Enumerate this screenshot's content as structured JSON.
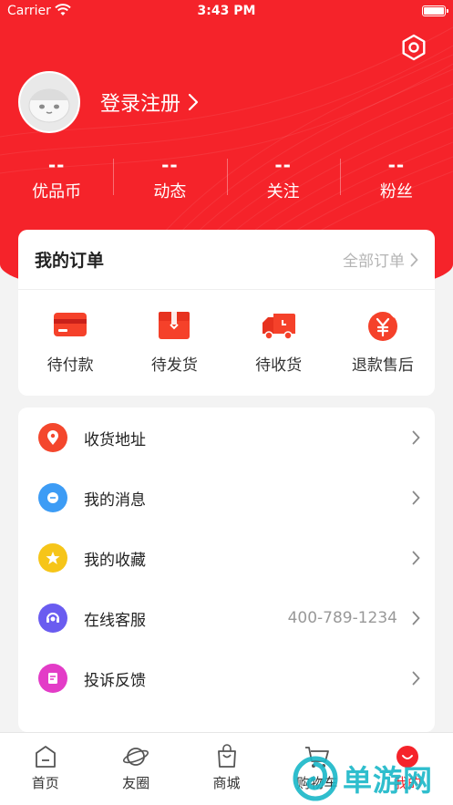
{
  "status_bar": {
    "carrier": "Carrier",
    "time": "3:43 PM"
  },
  "header": {
    "login_label": "登录注册",
    "stats": [
      {
        "value": "--",
        "label": "优品币"
      },
      {
        "value": "--",
        "label": "动态"
      },
      {
        "value": "--",
        "label": "关注"
      },
      {
        "value": "--",
        "label": "粉丝"
      }
    ]
  },
  "orders": {
    "title": "我的订单",
    "all_label": "全部订单",
    "items": [
      {
        "label": "待付款",
        "icon": "card-icon"
      },
      {
        "label": "待发货",
        "icon": "gift-box-icon"
      },
      {
        "label": "待收货",
        "icon": "truck-icon"
      },
      {
        "label": "退款售后",
        "icon": "yen-refund-icon"
      }
    ]
  },
  "menu": [
    {
      "label": "收货地址",
      "icon": "location-pin-icon",
      "value": ""
    },
    {
      "label": "我的消息",
      "icon": "message-icon",
      "value": ""
    },
    {
      "label": "我的收藏",
      "icon": "star-icon",
      "value": ""
    },
    {
      "label": "在线客服",
      "icon": "customer-service-icon",
      "value": "400-789-1234"
    },
    {
      "label": "投诉反馈",
      "icon": "feedback-icon",
      "value": ""
    }
  ],
  "tabbar": [
    {
      "label": "首页",
      "icon": "home-icon"
    },
    {
      "label": "友圈",
      "icon": "planet-icon"
    },
    {
      "label": "商城",
      "icon": "shopping-bag-icon"
    },
    {
      "label": "购物车",
      "icon": "cart-icon"
    },
    {
      "label": "我的",
      "icon": "profile-smile-icon"
    }
  ],
  "watermark": {
    "text": "单游网"
  },
  "colors": {
    "brand_red": "#f5232a",
    "order_icon_orange": "#f5412a",
    "location_icon": "#f4472d",
    "message_icon": "#3d9cf5",
    "star_icon": "#f6c519",
    "service_icon": "#6a5cf0",
    "feedback_icon": "#e33cc7",
    "watermark": "#19b7c8"
  }
}
